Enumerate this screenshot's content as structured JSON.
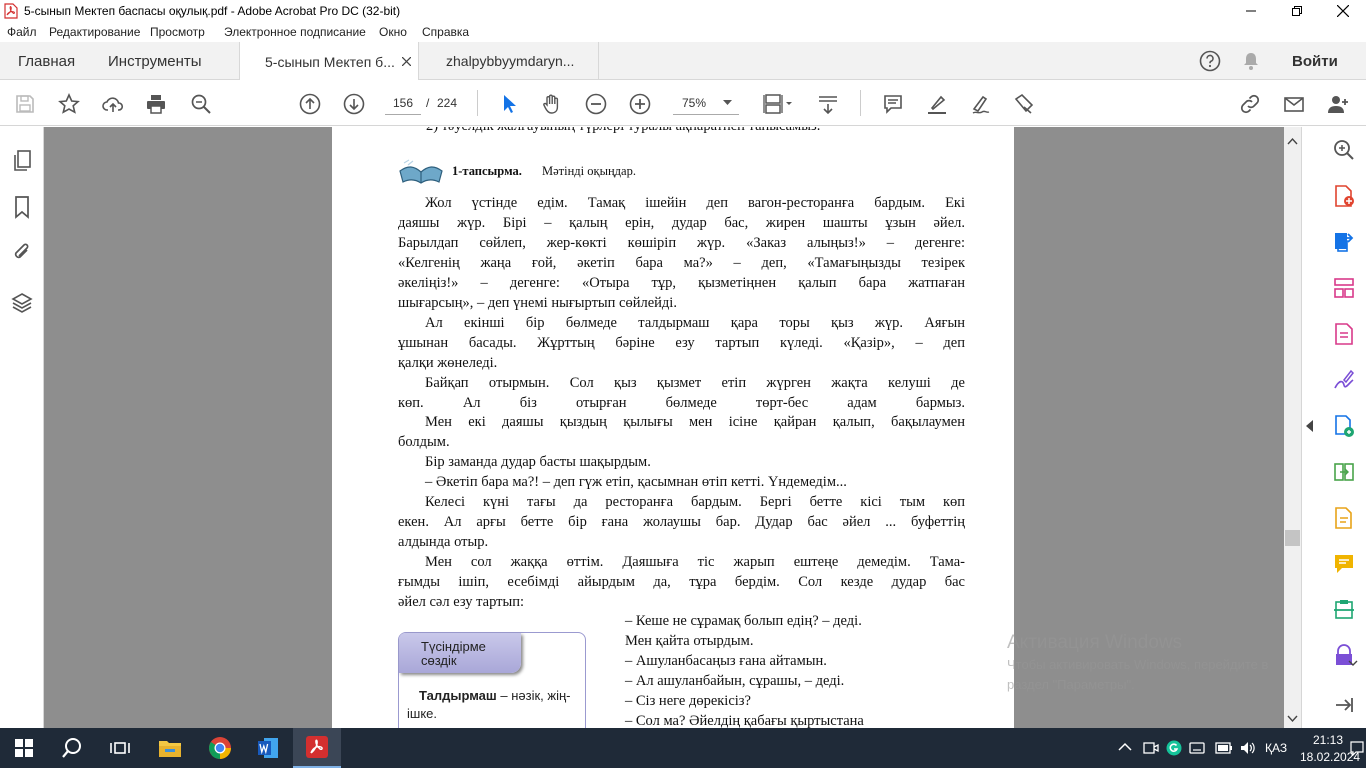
{
  "window": {
    "title": "5-сынып Мектеп баспасы оқулық.pdf - Adobe Acrobat Pro DC (32-bit)"
  },
  "menu": [
    "Файл",
    "Редактирование",
    "Просмотр",
    "Электронное подписание",
    "Окно",
    "Справка"
  ],
  "tabs": {
    "home": "Главная",
    "tools": "Инструменты",
    "doc1": "5-сынып Мектеп б...",
    "doc2": "zhalpybbyymdaryn...",
    "signin": "Войти"
  },
  "toolbar": {
    "page_current": "156",
    "page_separator": "/",
    "page_total": "224",
    "zoom": "75%"
  },
  "page": {
    "top_cut": "2) тәуелдік жалғауының түрлері туралы ақпаратпен танысамыз.",
    "task_label": "1-тапсырма.",
    "task_text": "Мәтінді оқыңдар.",
    "lines": [
      "Жол үстінде едім. Тамақ ішейін деп вагон-ресторанға бардым. Екі",
      "даяшы жүр. Бірі – қалың ерін, дудар бас, жирен шашты ұзын әйел.",
      "Барылдап сөйлеп, жер-көкті көшіріп жүр. «Заказ алыңыз!» – дегенге:",
      "«Келгенің жаңа ғой, әкетіп бара ма?» – деп, «Тамағыңызды тезірек",
      "әкеліңіз!» – дегенге: «Отыра тұр, қызметіңнен қалып бара жатпаған",
      "шығарсың», – деп үнемі нығыртып сөйлейді.",
      "Ал екінші бір бөлмеде талдырмаш қара торы қыз жүр. Аяғын",
      "ұшынан басады. Жұрттың бәріне езу тартып күледі. «Қазір», – деп",
      "қалқи жөнеледі.",
      "Байқап отырмын. Сол қыз қызмет етіп жүрген жақта келуші де",
      "көп. Ал біз отырған бөлмеде төрт-бес адам бармыз.",
      "Мен екі даяшы қыздың қылығы мен ісіне қайран қалып, бақылаумен",
      "болдым.",
      "Бір заманда дудар басты шақырдым.",
      "– Әкетіп бара ма?! – деп гүж етіп, қасымнан өтіп кетті. Үндемедім...",
      "Келесі күні тағы да ресторанға бардым. Бергі бетте кісі тым көп",
      "екен. Ал арғы бетте бір ғана жолаушы бар. Дудар бас әйел ... буфеттің",
      "алдында отыр.",
      "Мен сол жаққа өттім. Даяшыға тіс жарып ештеңе демедім. Тама-",
      "ғымды ішіп, есебімді айырдым да, тұра бердім. Сол кезде дудар бас",
      "әйел сәл езу тартып:"
    ],
    "dialog": [
      "– Кеше не сұрамақ болып едің? – деді.",
      "Мен қайта отырдым.",
      "– Ашуланбасаңыз ғана айтамын.",
      "– Ал ашуланбайын, сұрашы, – деді.",
      "– Сіз неге дөрекісіз?",
      "– Сол ма? Әйелдің қабағы қыртыстана"
    ],
    "glossary": {
      "title_line1": "Түсіндірме",
      "title_line2": "сөздік",
      "term": "Талдырмаш",
      "def1": " – нәзік, жің-",
      "def2": "ішке."
    }
  },
  "activation": {
    "line1": "Активация Windows",
    "line2": "Чтобы активировать Windows, перейдите в",
    "line3": "раздел \"Параметры\"."
  },
  "taskbar": {
    "lang": "ҚАЗ",
    "time": "21:13",
    "date": "18.02.2024"
  },
  "colors": {
    "acrobat_red": "#d32f2f",
    "accent_blue": "#1473e6",
    "taskbar": "#1f2a38",
    "doc_bg": "#8e8e8e"
  }
}
